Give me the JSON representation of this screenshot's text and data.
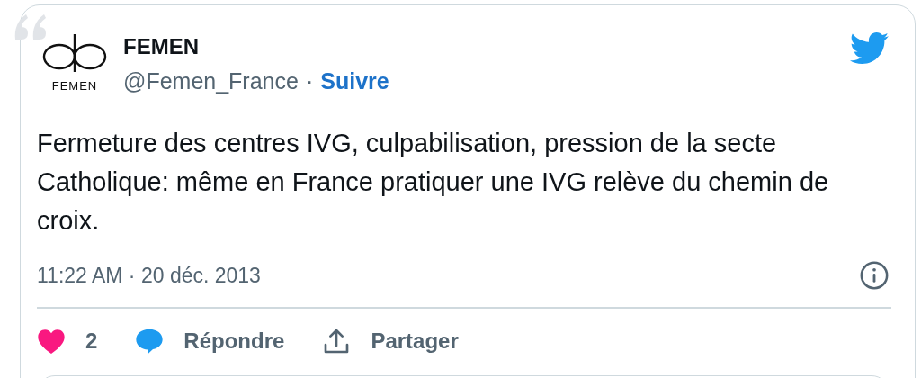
{
  "author": {
    "logo_text": "FEMEN",
    "name": "FEMEN",
    "handle": "@Femen_France",
    "separator": "·",
    "follow": "Suivre"
  },
  "text": "Fermeture des centres IVG, culpabilisation, pression de la secte Catholique: même en France pratiquer une IVG relève du chemin de croix.",
  "timestamp": "11:22 AM · 20 déc. 2013",
  "actions": [
    {
      "kind": "like",
      "label": "2"
    },
    {
      "kind": "reply",
      "label": "Répondre"
    },
    {
      "kind": "share",
      "label": "Partager"
    }
  ]
}
